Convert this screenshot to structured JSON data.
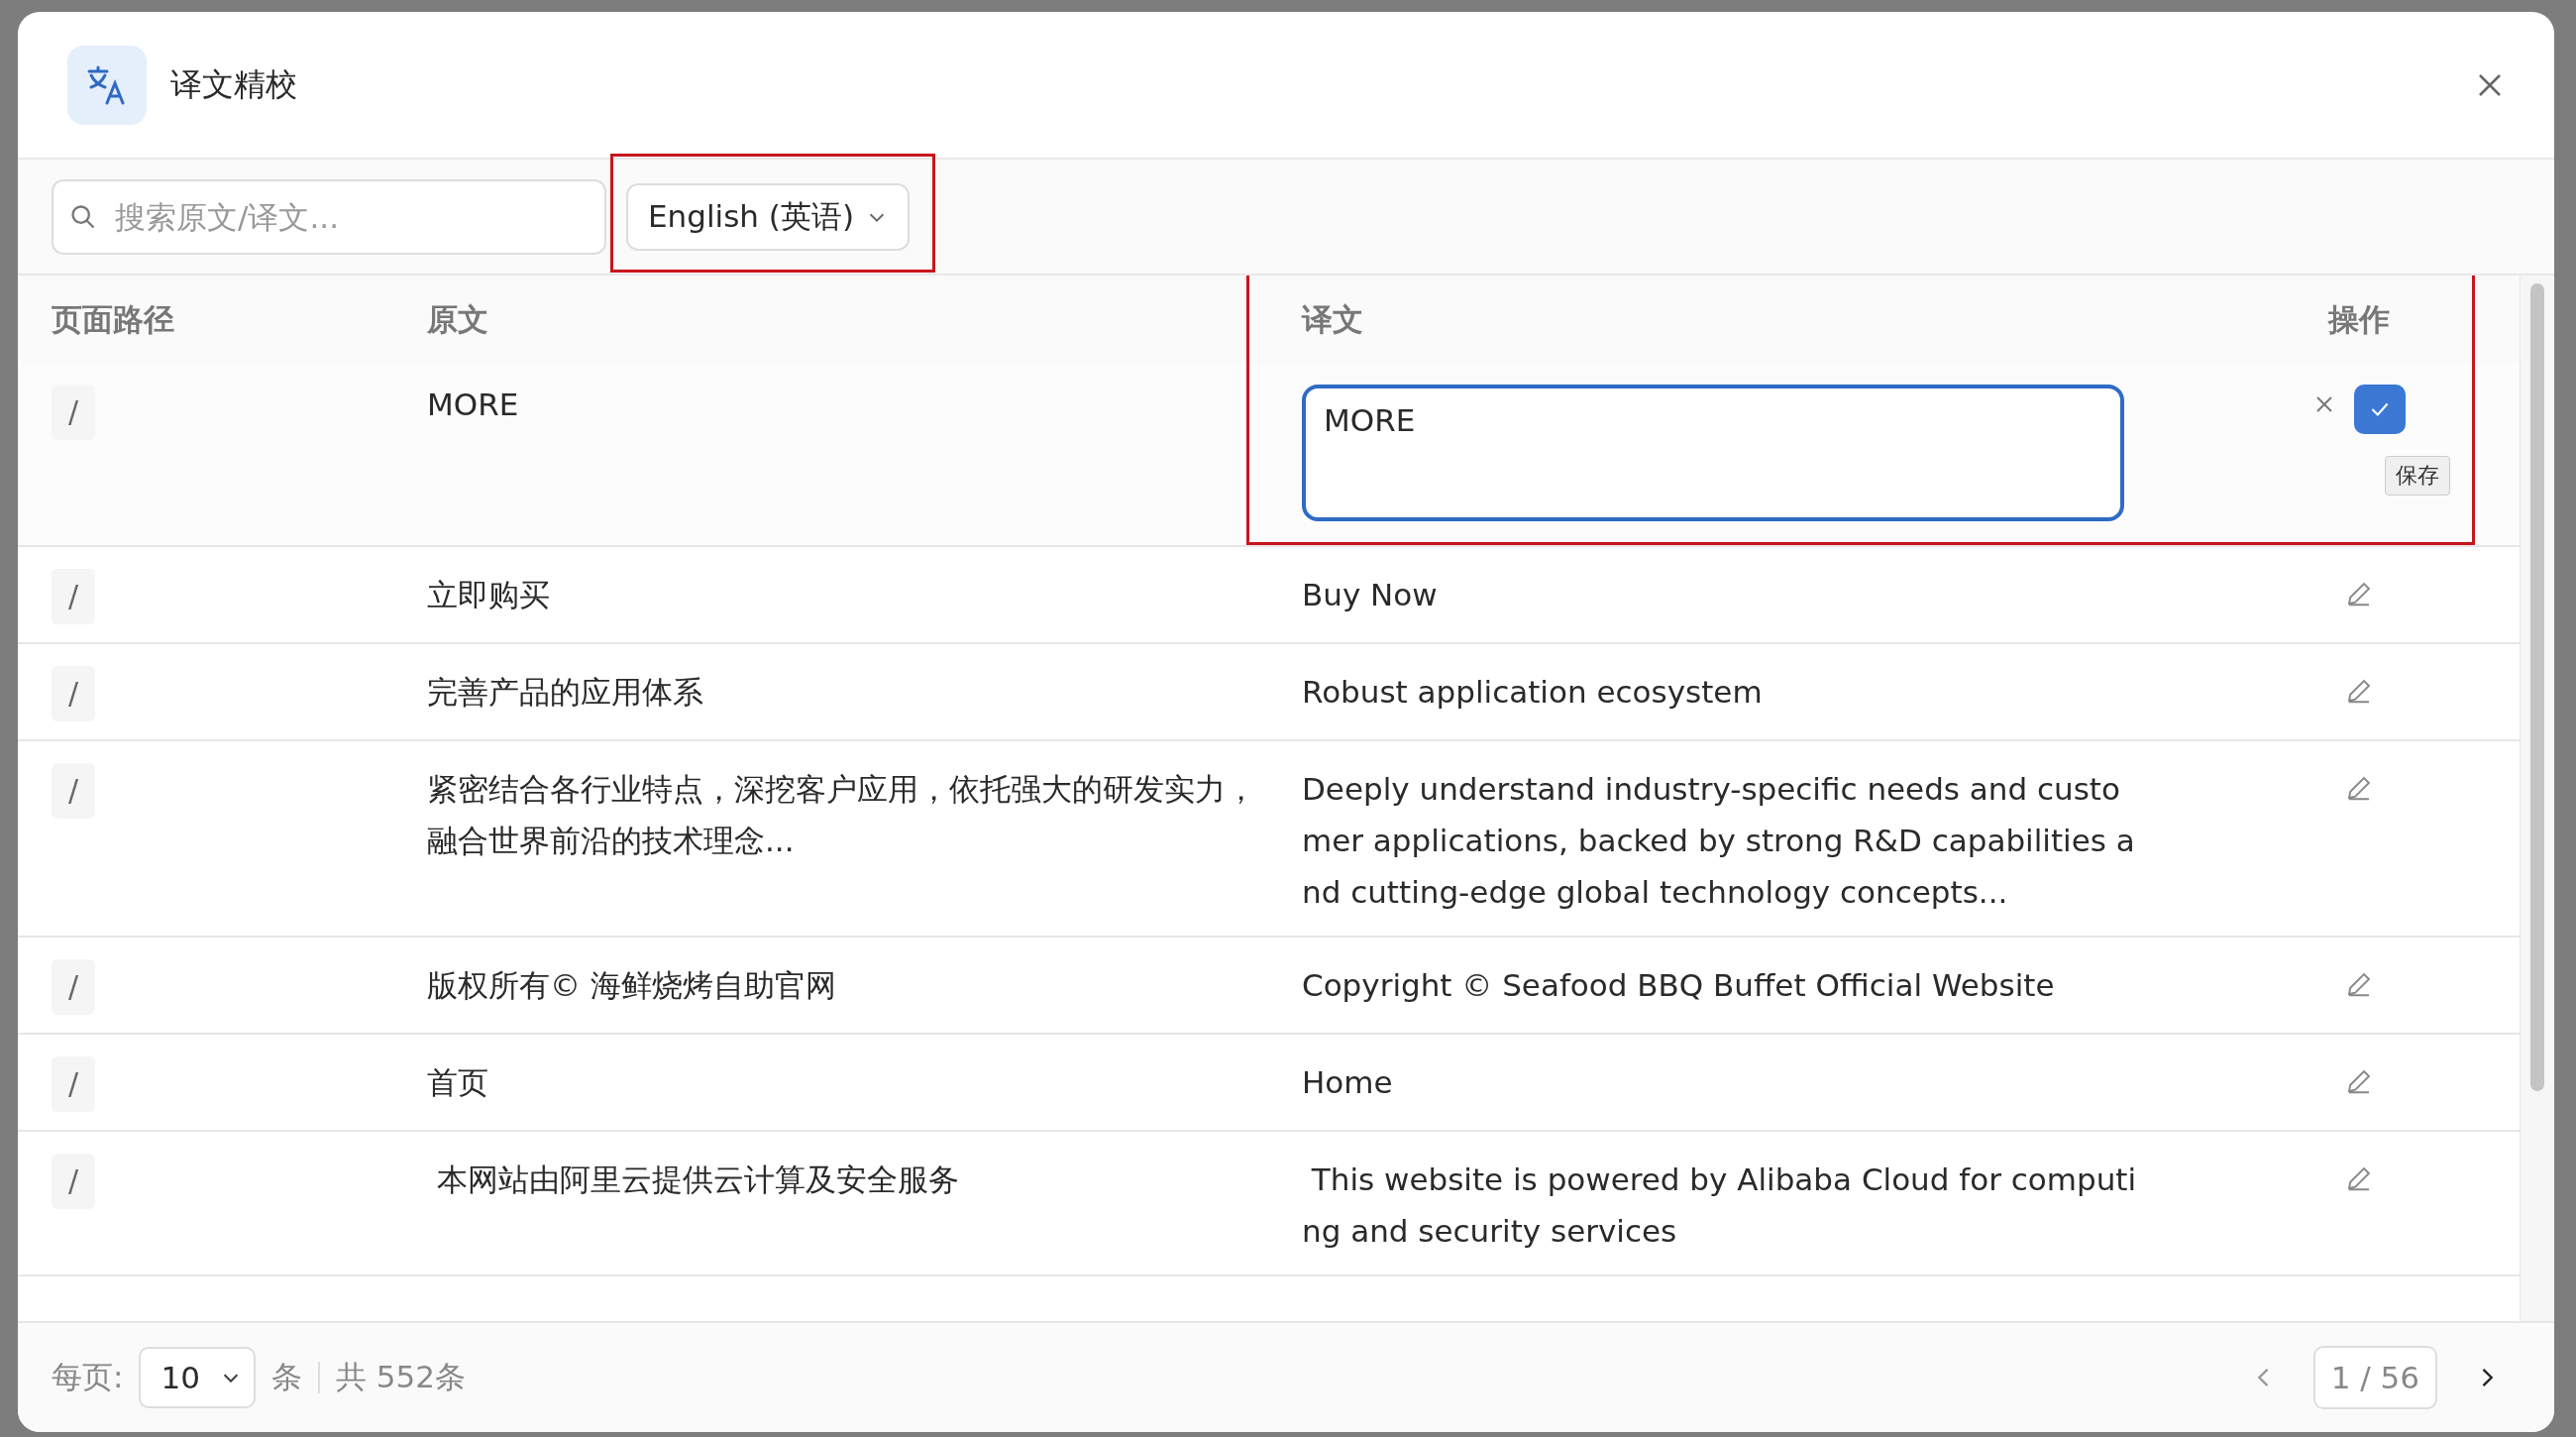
{
  "dialog": {
    "title": "译文精校"
  },
  "toolbar": {
    "search": {
      "placeholder": "搜索原文/译文..."
    },
    "language": {
      "value": "English (英语)"
    }
  },
  "table": {
    "columns": [
      "页面路径",
      "原文",
      "译文",
      "操作"
    ],
    "rows": [
      {
        "path": "/",
        "source": "MORE",
        "translation": "MORE",
        "editing": true,
        "tooltip": "保存"
      },
      {
        "path": "/",
        "source": "立即购买",
        "translation": "Buy Now",
        "editing": false
      },
      {
        "path": "/",
        "source": "完善产品的应用体系",
        "translation": "Robust application ecosystem",
        "editing": false
      },
      {
        "path": "/",
        "source": "紧密结合各行业特点，深挖客户应用，依托强大的研发实力，融合世界前沿的技术理念...",
        "translation": "Deeply understand industry-specific needs and customer applications, backed by strong R&D capabilities and cutting-edge global technology concepts...",
        "editing": false
      },
      {
        "path": "/",
        "source": "版权所有© 海鲜烧烤自助官网",
        "translation": "Copyright © Seafood BBQ Buffet Official Website",
        "editing": false
      },
      {
        "path": "/",
        "source": "首页",
        "translation": "Home",
        "editing": false
      },
      {
        "path": "/",
        "source": " 本网站由阿里云提供云计算及安全服务",
        "translation": " This website is powered by Alibaba Cloud for computing and security services",
        "editing": false
      }
    ]
  },
  "footer": {
    "page_size_label": "每页:",
    "page_size": "10",
    "unit": "条",
    "total": "共 552条",
    "page": "1 / 56"
  }
}
